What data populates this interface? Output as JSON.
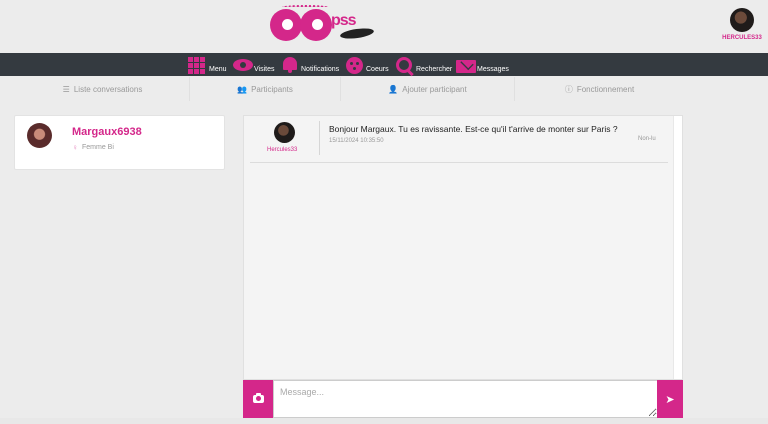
{
  "header": {
    "logo_text": "pss",
    "user": {
      "name": "HERCULES33"
    }
  },
  "nav": {
    "items": [
      {
        "label": "Menu",
        "icon": "grid-icon"
      },
      {
        "label": "Visites",
        "icon": "eye-icon"
      },
      {
        "label": "Notifications",
        "icon": "bell-icon"
      },
      {
        "label": "Coeurs",
        "icon": "heart-face-icon"
      },
      {
        "label": "Rechercher",
        "icon": "search-icon"
      },
      {
        "label": "Messages",
        "icon": "envelope-icon"
      }
    ]
  },
  "tabs": [
    {
      "label": "Liste conversations",
      "icon": "list-icon"
    },
    {
      "label": "Participants",
      "icon": "users-icon"
    },
    {
      "label": "Ajouter participant",
      "icon": "user-plus-icon"
    },
    {
      "label": "Fonctionnement",
      "icon": "question-circle-icon"
    }
  ],
  "contact": {
    "name": "Margaux6938",
    "subtitle": "Femme Bi",
    "gender_icon": "venus-icon"
  },
  "messages": [
    {
      "author": "Hercules33",
      "text": "Bonjour Margaux. Tu es ravissante. Est-ce qu'il t'arrive de monter sur Paris ?",
      "date": "15/11/2024 10:35:50",
      "status": "Non-lu"
    }
  ],
  "composer": {
    "placeholder": "Message...",
    "value": ""
  },
  "colors": {
    "accent": "#d4278a",
    "navbar": "#343a40",
    "background": "#ececec"
  }
}
